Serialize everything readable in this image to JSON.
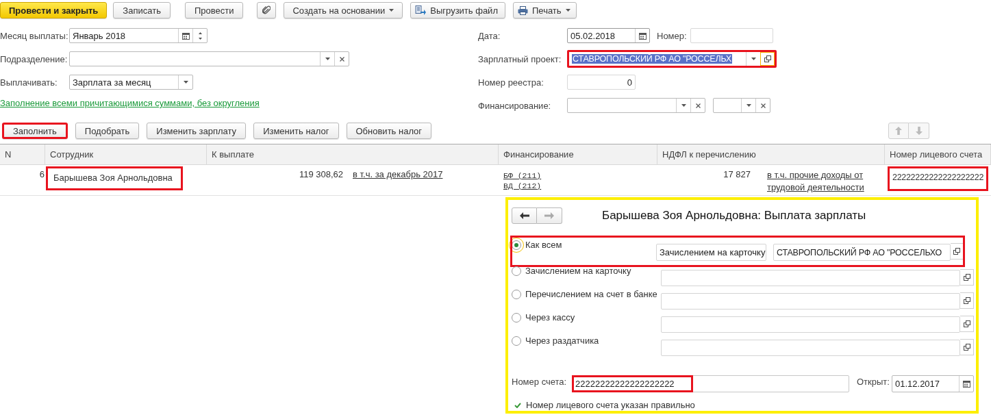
{
  "toolbar": {
    "buttons": [
      {
        "kind": "primary",
        "label": "Провести и закрыть"
      },
      {
        "kind": "plain",
        "label": "Записать"
      },
      {
        "kind": "plain",
        "label": "Провести"
      },
      {
        "kind": "attach"
      },
      {
        "kind": "menu",
        "label": "Создать на основании"
      },
      {
        "kind": "export",
        "label": "Выгрузить файл"
      },
      {
        "kind": "print",
        "label": "Печать"
      }
    ]
  },
  "form": {
    "left": [
      {
        "kind": "month",
        "label": "Месяц выплаты:",
        "value": "Январь 2018"
      },
      {
        "kind": "select-clear",
        "label": "Подразделение:"
      },
      {
        "kind": "select",
        "label": "Выплачивать:",
        "value": "Зарплата за месяц"
      }
    ],
    "fill_link": "Заполнение всеми причитающимися суммами, без округления",
    "right": [
      {
        "kind": "date",
        "label": "Дата:",
        "value": "05.02.2018",
        "number_label": "Номер:"
      },
      {
        "kind": "project",
        "label": "Зарплатный проект:",
        "value": "СТАВРОПОЛЬСКИЙ РФ АО \"РОССЕЛЬХ",
        "text_selected": true,
        "focused": true,
        "highlighted": true
      },
      {
        "kind": "number",
        "label": "Номер реестра:",
        "value": "0"
      },
      {
        "kind": "double-select",
        "label": "Финансирование:"
      }
    ]
  },
  "actions": {
    "buttons": [
      {
        "label": "Заполнить",
        "highlighted": true
      },
      {
        "label": "Подобрать",
        "highlighted": false
      },
      {
        "label": "Изменить зарплату",
        "highlighted": false
      },
      {
        "label": "Изменить налог",
        "highlighted": false
      },
      {
        "label": "Обновить налог",
        "highlighted": false
      }
    ]
  },
  "table": {
    "columns": [
      "N",
      "Сотрудник",
      "К выплате",
      "Финансирование",
      "НДФЛ к перечислению",
      "Номер лицевого счета"
    ],
    "rows": [
      {
        "n": "6",
        "employee": "Барышева Зоя Арнольдовна",
        "employee_highlighted": true,
        "amount": "119 308,62",
        "amount_link": "в т.ч. за декабрь 2017",
        "financing": [
          "БФ (211)",
          "ВД (212)"
        ],
        "tax": "17 827",
        "tax_link": "в т.ч. прочие доходы от трудовой деятельности",
        "account": "22222222222222222222",
        "account_highlighted": true
      }
    ]
  },
  "popup": {
    "title": "Барышева Зоя Арнольдовна: Выплата зарплаты",
    "options": [
      {
        "label": "Как всем",
        "selected": true,
        "method": "Зачислением на карточку",
        "value": "СТАВРОПОЛЬСКИЙ РФ АО \"РОССЕЛЬХО",
        "highlighted": true
      },
      {
        "label": "Зачислением на карточку",
        "selected": false,
        "highlighted": false
      },
      {
        "label": "Перечислением на счет в банке",
        "selected": false,
        "highlighted": false
      },
      {
        "label": "Через кассу",
        "selected": false,
        "highlighted": false
      },
      {
        "label": "Через раздатчика",
        "selected": false,
        "highlighted": false
      }
    ],
    "account_label": "Номер счета:",
    "account": "22222222222222222222",
    "account_highlighted": true,
    "opened_label": "Открыт:",
    "opened": "01.12.2017",
    "check_message": "Номер лицевого счета указан правильно"
  }
}
